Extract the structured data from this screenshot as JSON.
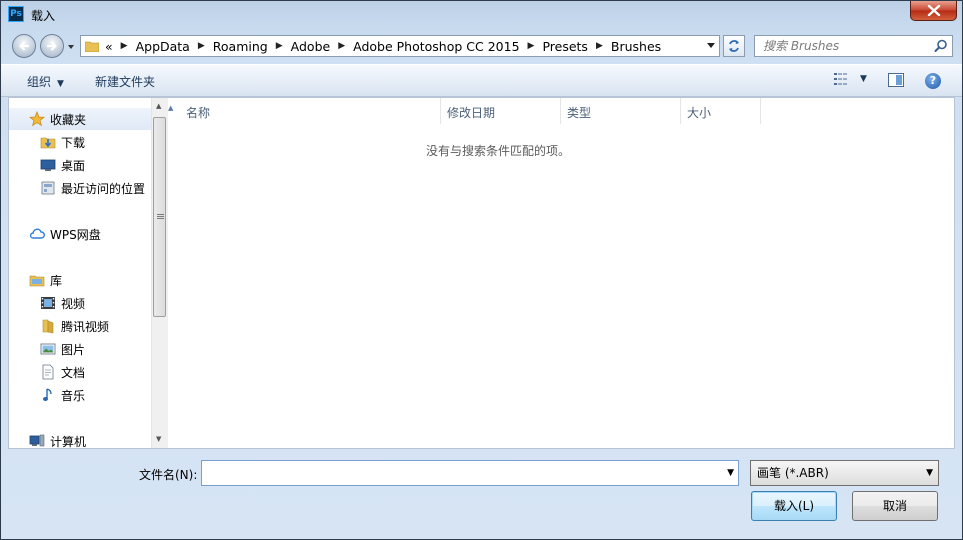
{
  "window": {
    "app_icon_text": "Ps",
    "title": "载入"
  },
  "nav": {
    "address": [
      "AppData",
      "Roaming",
      "Adobe",
      "Adobe Photoshop CC 2015",
      "Presets",
      "Brushes"
    ],
    "overflow_glyph": "«",
    "search_placeholder": "搜索 Brushes"
  },
  "toolbar": {
    "organize": "组织",
    "new_folder": "新建文件夹"
  },
  "sidebar": {
    "items": [
      {
        "label": "收藏夹",
        "icon": "star-icon"
      },
      {
        "label": "下载",
        "icon": "download-folder-icon"
      },
      {
        "label": "桌面",
        "icon": "desktop-icon"
      },
      {
        "label": "最近访问的位置",
        "icon": "recent-places-icon"
      },
      {
        "label": "WPS网盘",
        "icon": "cloud-icon"
      },
      {
        "label": "库",
        "icon": "library-icon"
      },
      {
        "label": "视频",
        "icon": "video-icon"
      },
      {
        "label": "腾讯视频",
        "icon": "folder-icon"
      },
      {
        "label": "图片",
        "icon": "pictures-icon"
      },
      {
        "label": "文档",
        "icon": "documents-icon"
      },
      {
        "label": "音乐",
        "icon": "music-icon"
      },
      {
        "label": "计算机",
        "icon": "computer-icon"
      }
    ]
  },
  "columns": [
    "名称",
    "修改日期",
    "类型",
    "大小"
  ],
  "empty_message": "没有与搜索条件匹配的项。",
  "footer": {
    "filename_label": "文件名(N):",
    "filename_value": "",
    "filetype_value": "画笔 (*.ABR)",
    "open_button": "载入(L)",
    "cancel_button": "取消"
  },
  "colors": {
    "accent": "#1e395b",
    "selection": "#dfe9f6"
  }
}
